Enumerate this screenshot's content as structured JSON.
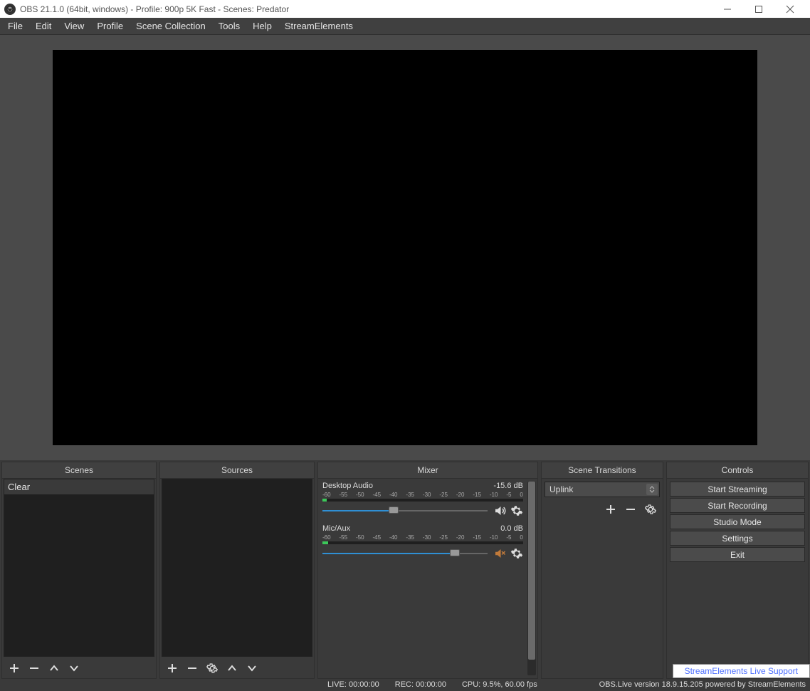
{
  "window": {
    "title": "OBS 21.1.0 (64bit, windows) - Profile: 900p 5K Fast - Scenes: Predator"
  },
  "menu": {
    "items": [
      "File",
      "Edit",
      "View",
      "Profile",
      "Scene Collection",
      "Tools",
      "Help",
      "StreamElements"
    ]
  },
  "docks": {
    "scenes": {
      "title": "Scenes",
      "items": [
        "Clear"
      ]
    },
    "sources": {
      "title": "Sources",
      "items": []
    },
    "mixer": {
      "title": "Mixer",
      "ticks": [
        "-60",
        "-55",
        "-50",
        "-45",
        "-40",
        "-35",
        "-30",
        "-25",
        "-20",
        "-15",
        "-10",
        "-5",
        "0"
      ],
      "channels": [
        {
          "name": "Desktop Audio",
          "db": "-15.6 dB",
          "slider_pct": 43,
          "level_mask_pct": 98,
          "muted": false
        },
        {
          "name": "Mic/Aux",
          "db": "0.0 dB",
          "slider_pct": 80,
          "level_mask_pct": 97,
          "muted": true
        }
      ]
    },
    "transitions": {
      "title": "Scene Transitions",
      "selected": "Uplink"
    },
    "controls": {
      "title": "Controls",
      "buttons": [
        "Start Streaming",
        "Start Recording",
        "Studio Mode",
        "Settings",
        "Exit"
      ]
    }
  },
  "support_link": "StreamElements Live Support",
  "status": {
    "live": "LIVE: 00:00:00",
    "rec": "REC: 00:00:00",
    "cpu": "CPU: 9.5%, 60.00 fps",
    "version": "OBS.Live version 18.9.15.205 powered by StreamElements"
  }
}
